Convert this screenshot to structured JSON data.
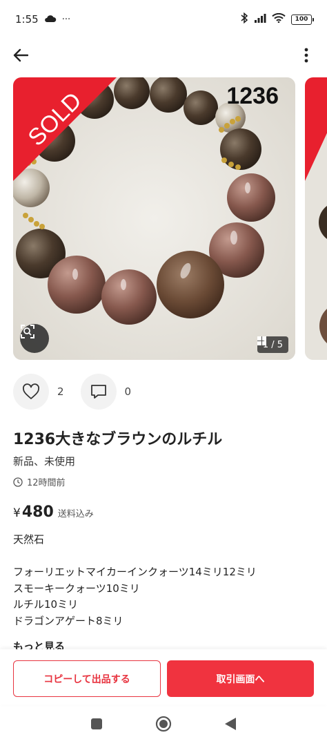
{
  "status_bar": {
    "time": "1:55",
    "overflow": "···",
    "battery": "100"
  },
  "listing": {
    "photo_number": "1236",
    "sold_badge": "SOLD",
    "photo_counter": "1 / 5",
    "likes": "2",
    "comments": "0",
    "title": "1236大きなブラウンのルチル",
    "condition": "新品、未使用",
    "posted": "12時間前",
    "price_currency": "¥",
    "price": "480",
    "price_note": "送料込み",
    "description": [
      "天然石",
      "",
      "フォーリエットマイカーインクォーツ14ミリ12ミリ",
      "スモーキークォーツ10ミリ",
      "ルチル10ミリ",
      "ドラゴンアゲート8ミリ"
    ],
    "more_label": "もっと見る"
  },
  "actions": {
    "copy_label": "コピーして出品する",
    "trade_label": "取引画面へ"
  },
  "colors": {
    "accent": "#f0333f",
    "sold_banner": "#e8202e"
  },
  "icons": [
    "back-arrow-icon",
    "more-vert-icon",
    "image-search-icon",
    "grid-icon",
    "heart-icon",
    "comment-icon",
    "clock-icon",
    "bluetooth-icon",
    "signal-icon",
    "wifi-icon",
    "cloud-icon"
  ]
}
